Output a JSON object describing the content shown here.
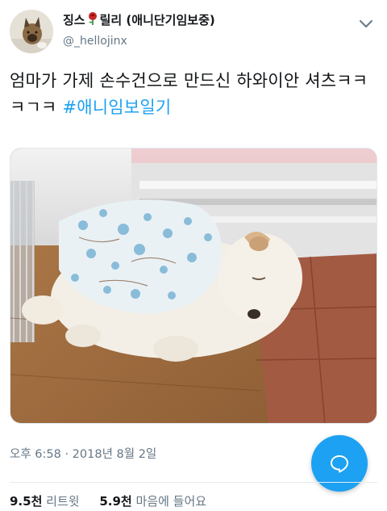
{
  "author": {
    "display_name_before": "징스",
    "display_name_after": "릴리 (애니단기임보중)",
    "handle": "@_hellojinx"
  },
  "tweet": {
    "text": "엄마가 가제 손수건으로 만드신 하와이안 셔츠ㅋㅋㅋㄱㅋ ",
    "hashtag": "#애니임보일기"
  },
  "timestamp": "오후 6:58 · 2018년 8월 2일",
  "stats": {
    "retweets_count": "9.5천",
    "retweets_label": "리트윗",
    "likes_count": "5.9천",
    "likes_label": "마음에 들어요"
  },
  "icons": {
    "menu": "chevron-down-icon",
    "compose": "reply-bubble-icon",
    "emoji": "rose-icon"
  },
  "colors": {
    "accent": "#1da1f2",
    "text": "#14171a",
    "secondary": "#657786"
  }
}
